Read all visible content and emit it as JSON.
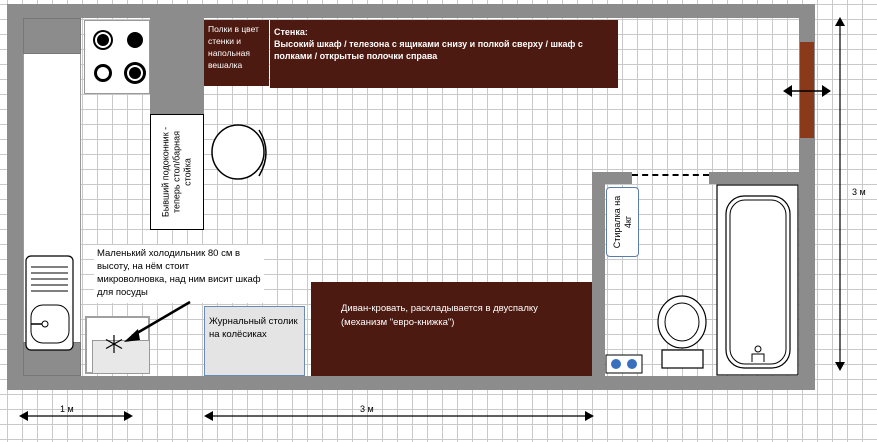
{
  "labels": {
    "shelves": "Полки в цвет стенки и напольная вешалка",
    "wall_title": "Стенка:",
    "wall_desc": "Высокий шкаф / телезона с ящиками снизу и полкой сверху / шкаф с полками / открытые полочки справа",
    "bar": "Бывший подоконник - теперь стол/барная стойка",
    "washer": "Стиралка на 4кг",
    "fridge": "Маленький холодильник 80 см в высоту, на нём стоит микроволновка, над ним висит шкаф для посуды",
    "table": "Журнальный столик на колёсиках",
    "sofa": "Диван-кровать, раскладывается в двуспалку (механизм \"евро-книжка\")"
  },
  "dimensions": {
    "left_bottom": "1 м",
    "mid_bottom": "3 м",
    "right_side": "3 м"
  },
  "colors": {
    "wall": "#8c8c8c",
    "furniture": "#4d1a11",
    "grid": "#c9c9c9"
  }
}
